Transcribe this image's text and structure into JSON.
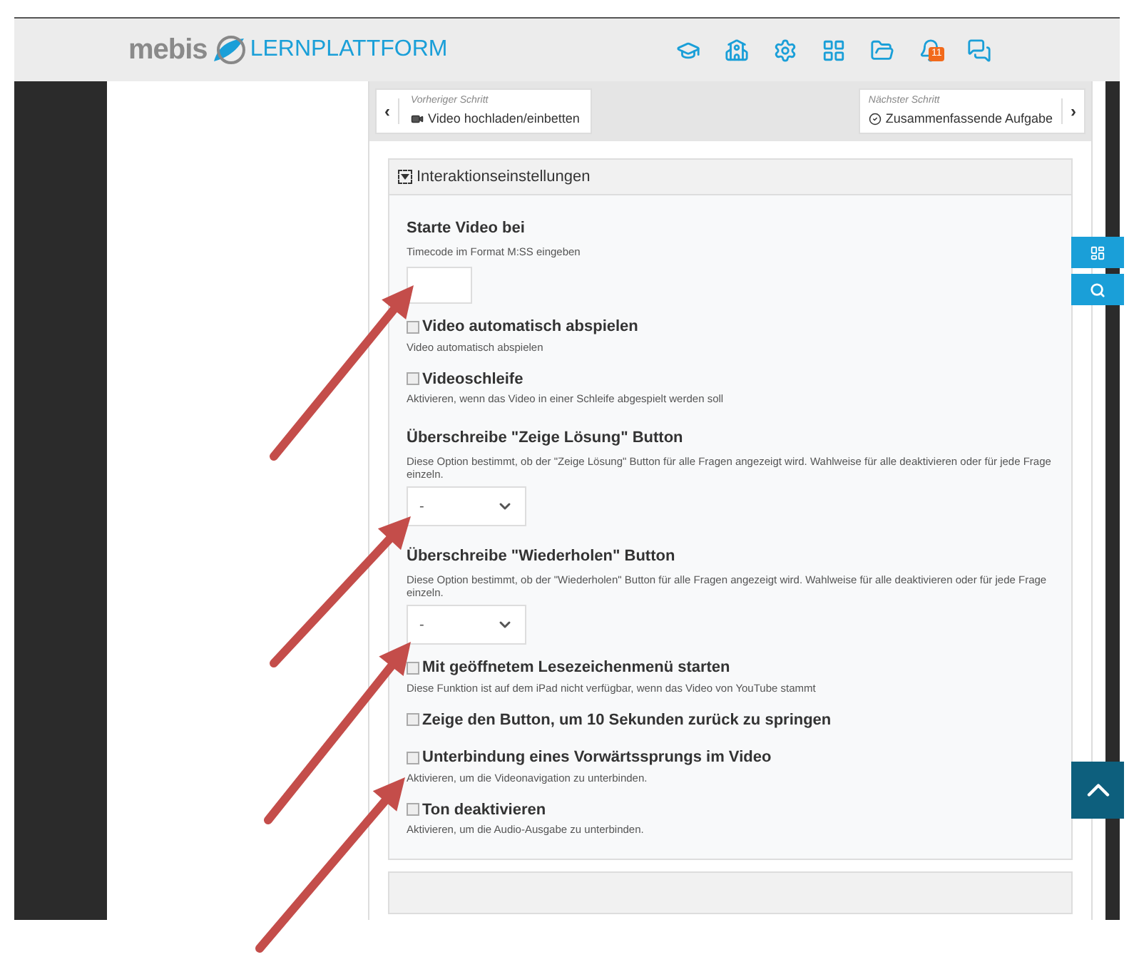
{
  "header": {
    "logo_text": "mebis",
    "logo_subtitle": "LERNPLATTFORM",
    "notification_count": "11"
  },
  "step_nav": {
    "previous": {
      "caption": "Vorheriger Schritt",
      "title": "Video hochladen/einbetten",
      "arrow": "‹"
    },
    "next": {
      "caption": "Nächster Schritt",
      "title": "Zusammenfassende Aufgabe",
      "arrow": "›"
    }
  },
  "panel": {
    "title": "Interaktionseinstellungen",
    "expanded": true,
    "fields": [
      {
        "kind": "text",
        "label": "Starte Video bei",
        "hint": "Timecode im Format M:SS eingeben"
      },
      {
        "kind": "checkbox",
        "label": "Video automatisch abspielen",
        "hint": "Video automatisch abspielen",
        "checked": false
      },
      {
        "kind": "checkbox",
        "label": "Videoschleife",
        "hint": "Aktivieren, wenn das Video in einer Schleife abgespielt werden soll",
        "checked": false
      },
      {
        "kind": "select",
        "label": "Überschreibe \"Zeige Lösung\" Button",
        "hint": "Diese Option bestimmt, ob der \"Zeige Lösung\" Button für alle Fragen angezeigt wird. Wahlweise für alle deaktivieren oder für jede Frage einzeln.",
        "value": "-"
      },
      {
        "kind": "select",
        "label": "Überschreibe \"Wiederholen\" Button",
        "hint": "Diese Option bestimmt, ob der \"Wiederholen\" Button für alle Fragen angezeigt wird. Wahlweise für alle deaktivieren oder für jede Frage einzeln.",
        "value": "-"
      },
      {
        "kind": "checkbox",
        "label": "Mit geöffnetem Lesezeichenmenü starten",
        "hint": "Diese Funktion ist auf dem iPad nicht verfügbar, wenn das Video von YouTube stammt",
        "checked": false
      },
      {
        "kind": "checkbox",
        "label": "Zeige den Button, um 10 Sekunden zurück zu springen",
        "checked": false
      },
      {
        "kind": "checkbox",
        "label": "Unterbindung eines Vorwärtssprungs im Video",
        "hint": "Aktivieren, um die Videonavigation zu unterbinden.",
        "checked": false
      },
      {
        "kind": "checkbox",
        "label": "Ton deaktivieren",
        "hint": "Aktivieren, um die Audio-Ausgabe zu unterbinden.",
        "checked": false
      }
    ]
  }
}
